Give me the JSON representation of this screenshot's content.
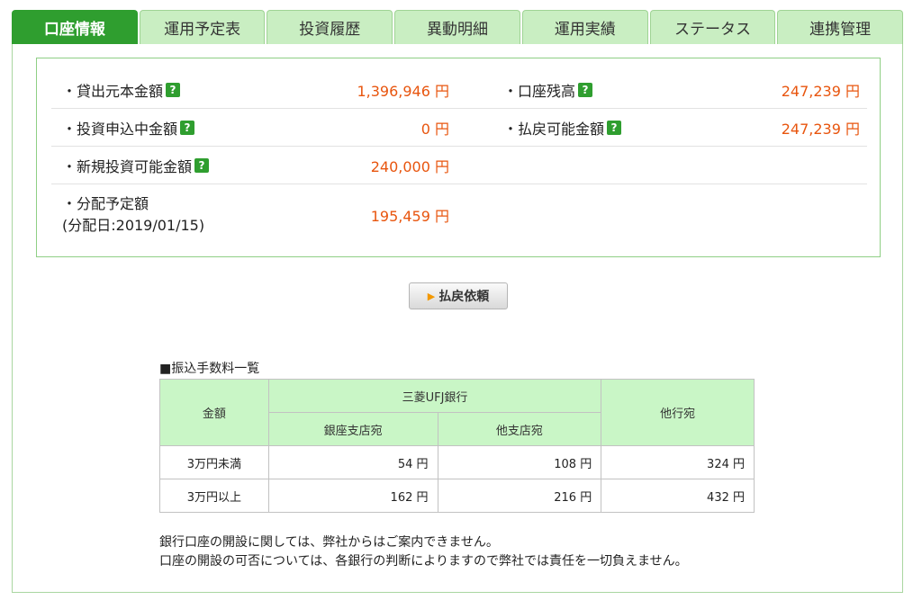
{
  "tabs": [
    {
      "label": "口座情報",
      "active": true
    },
    {
      "label": "運用予定表",
      "active": false
    },
    {
      "label": "投資履歴",
      "active": false
    },
    {
      "label": "異動明細",
      "active": false
    },
    {
      "label": "運用実績",
      "active": false
    },
    {
      "label": "ステータス",
      "active": false
    },
    {
      "label": "連携管理",
      "active": false
    }
  ],
  "summary": {
    "loan_principal_label": "・貸出元本金額",
    "loan_principal_value": "1,396,946 円",
    "account_balance_label": "・口座残高",
    "account_balance_value": "247,239 円",
    "investment_applying_label": "・投資申込中金額",
    "investment_applying_value": "0 円",
    "refundable_label": "・払戻可能金額",
    "refundable_value": "247,239 円",
    "new_investable_label": "・新規投資可能金額",
    "new_investable_value": "240,000 円",
    "distribution_label": "・分配予定額",
    "distribution_date": "(分配日:2019/01/15)",
    "distribution_value": "195,459 円",
    "help_glyph": "?"
  },
  "refund_button": {
    "label": "払戻依頼",
    "arrow": "▶"
  },
  "fee_table": {
    "title": "■振込手数料一覧",
    "header_amount": "金額",
    "header_bank": "三菱UFJ銀行",
    "header_branch_ginza": "銀座支店宛",
    "header_branch_other": "他支店宛",
    "header_other_bank": "他行宛",
    "rows": [
      {
        "label": "3万円未満",
        "ginza": "54 円",
        "other_branch": "108 円",
        "other_bank": "324 円"
      },
      {
        "label": "3万円以上",
        "ginza": "162 円",
        "other_branch": "216 円",
        "other_bank": "432 円"
      }
    ]
  },
  "notes": {
    "line1": "銀行口座の開設に関しては、弊社からはご案内できません。",
    "line2": "口座の開設の可否については、各銀行の判断によりますので弊社では責任を一切負えません。"
  },
  "colors": {
    "accent": "#2f9e2f",
    "tab_bg": "#c9eec2",
    "value": "#e8550e",
    "table_header": "#c9f6c6"
  }
}
